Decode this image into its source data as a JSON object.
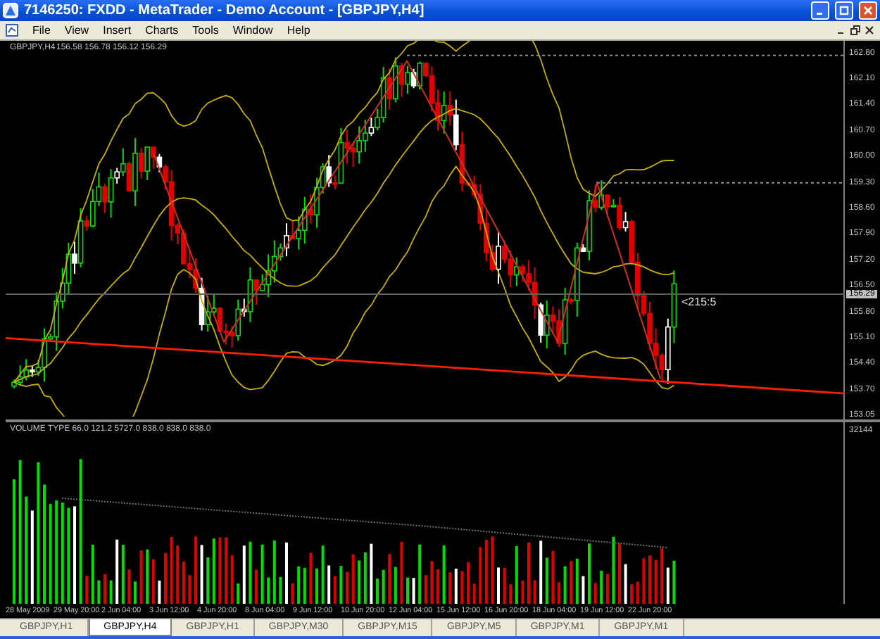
{
  "window": {
    "title": "7146250: FXDD - MetaTrader - Demo Account - [GBPJPY,H4]"
  },
  "menu": [
    "File",
    "View",
    "Insert",
    "Charts",
    "Tools",
    "Window",
    "Help"
  ],
  "chart": {
    "symbol": "GBPJPY,H4",
    "ohlc": "156.58 156.78 156.12 156.29",
    "countdown": "<215:5",
    "current_price": "156.29",
    "price_axis": [
      "162.80",
      "162.10",
      "161.40",
      "160.70",
      "160.00",
      "159.30",
      "158.60",
      "157.90",
      "157.20",
      "156.50",
      "155.80",
      "155.10",
      "154.40",
      "153.70",
      "153.05"
    ]
  },
  "volume": {
    "label": "VOLUME TYPE 66.0 121.2 5727.0 838.0 838.0 838.0",
    "axis_max": "32144"
  },
  "time_axis": [
    "28 May 2009",
    "29 May 20:00",
    "2 Jun 04:00",
    "3 Jun 12:00",
    "4 Jun 20:00",
    "8 Jun 04:00",
    "9 Jun 12:00",
    "10 Jun 20:00",
    "12 Jun 04:00",
    "15 Jun 12:00",
    "16 Jun 20:00",
    "18 Jun 04:00",
    "19 Jun 12:00",
    "22 Jun 20:00"
  ],
  "tabs": [
    {
      "label": "GBPJPY,H1",
      "selected": false
    },
    {
      "label": "GBPJPY,H4",
      "selected": true
    },
    {
      "label": "GBPJPY,H1",
      "selected": false
    },
    {
      "label": "GBPJPY,M30",
      "selected": false
    },
    {
      "label": "GBPJPY,M15",
      "selected": false
    },
    {
      "label": "GBPJPY,M5",
      "selected": false
    },
    {
      "label": "GBPJPY,M1",
      "selected": false
    },
    {
      "label": "GBPJPY,M1",
      "selected": false
    }
  ]
}
